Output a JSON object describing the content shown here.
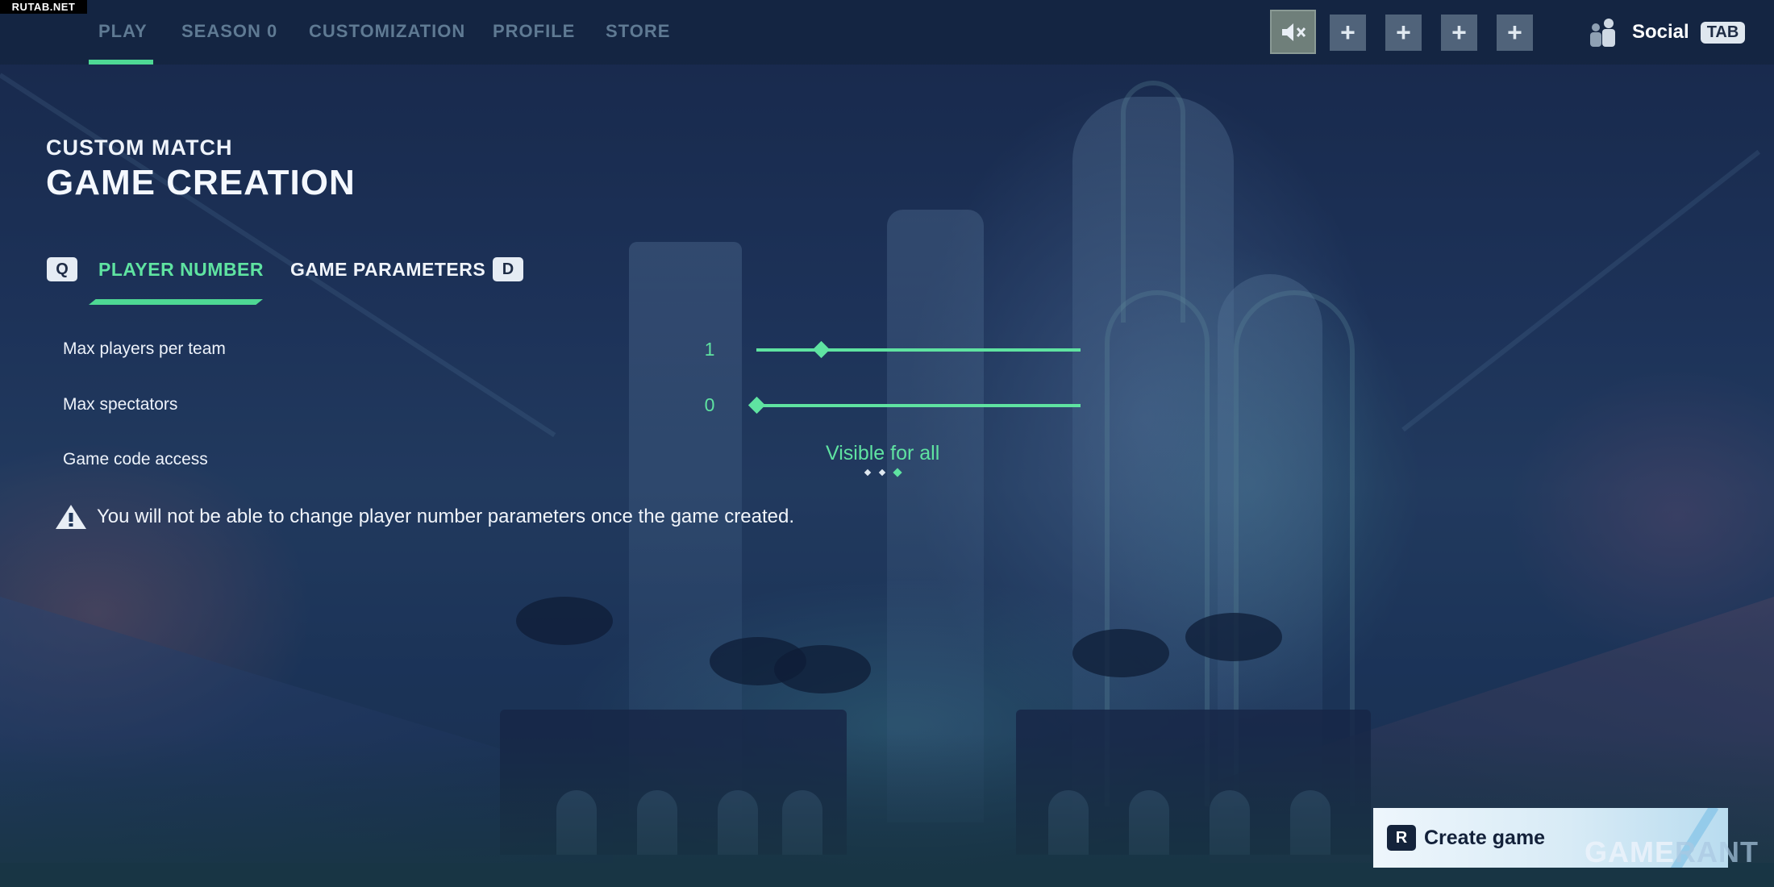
{
  "watermark": "RUTAB.NET",
  "nav": {
    "tabs": [
      {
        "label": "PLAY",
        "active": true
      },
      {
        "label": "SEASON 0",
        "active": false
      },
      {
        "label": "CUSTOMIZATION",
        "active": false
      },
      {
        "label": "PROFILE",
        "active": false
      },
      {
        "label": "STORE",
        "active": false
      }
    ],
    "party_slots": [
      "+",
      "+",
      "+",
      "+"
    ],
    "social_label": "Social",
    "social_key": "TAB",
    "mute_icon": "speaker-muted-icon"
  },
  "header": {
    "subtitle": "CUSTOM MATCH",
    "title": "GAME CREATION"
  },
  "subtabs": {
    "prev_key": "Q",
    "next_key": "D",
    "items": [
      {
        "label": "PLAYER NUMBER",
        "active": true
      },
      {
        "label": "GAME PARAMETERS",
        "active": false
      }
    ]
  },
  "settings": {
    "max_players": {
      "label": "Max players per team",
      "value": "1",
      "slider_fraction": 0.2
    },
    "max_spectators": {
      "label": "Max spectators",
      "value": "0",
      "slider_fraction": 0.0
    },
    "code_access": {
      "label": "Game code access",
      "value": "Visible for all",
      "option_count": 3,
      "selected_index": 2
    }
  },
  "warning": {
    "icon": "warning-triangle-icon",
    "text": "You will not be able to change player number parameters once the game created."
  },
  "action": {
    "key": "R",
    "label": "Create game"
  },
  "branding": {
    "game": "GAME",
    "rant": "RANT"
  },
  "colors": {
    "accent": "#5fe3a1",
    "background": "#1c2d4f"
  }
}
